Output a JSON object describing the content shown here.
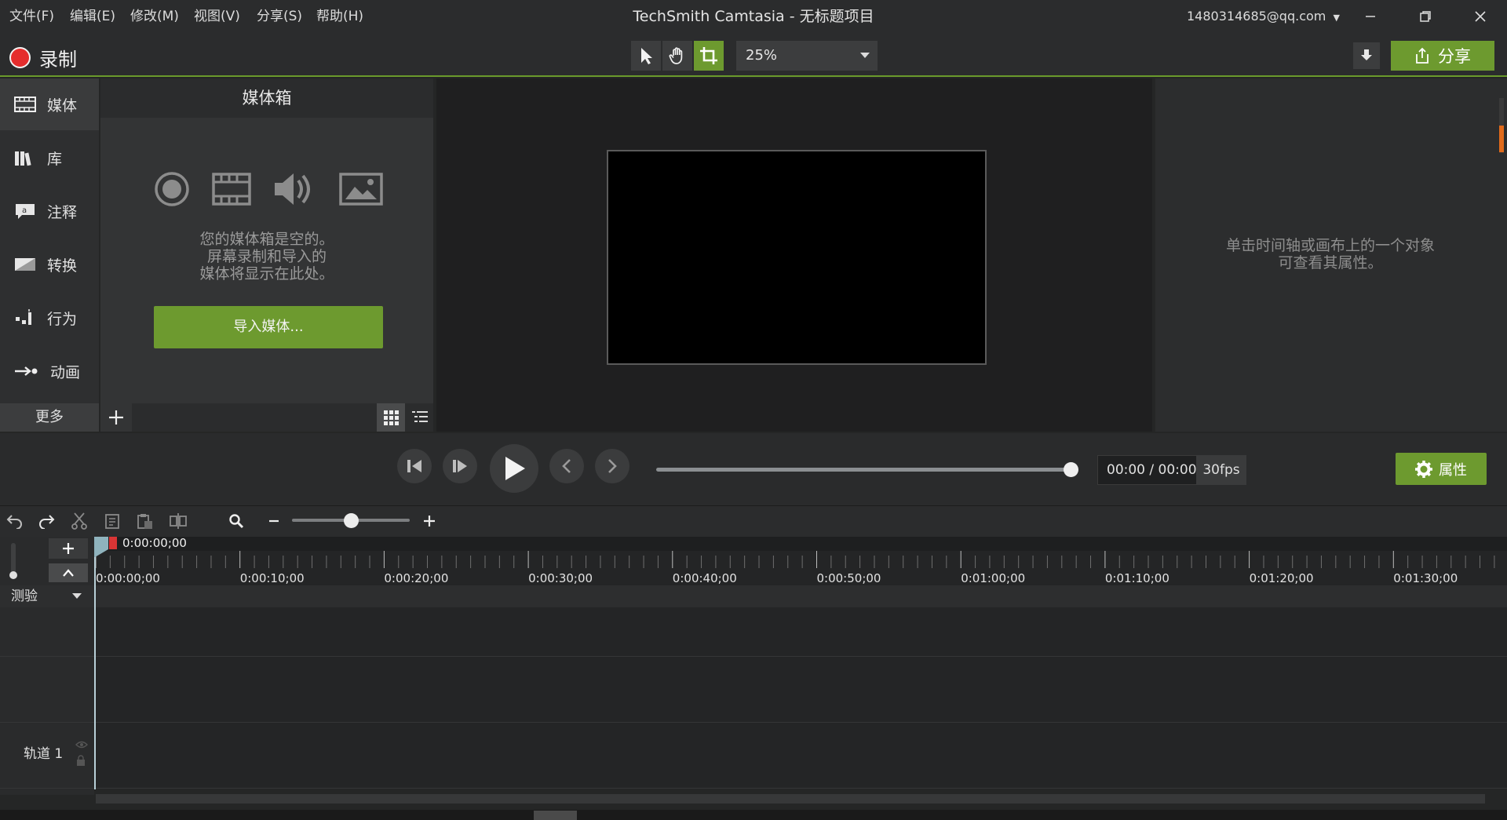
{
  "window": {
    "title": "TechSmith Camtasia - 无标题项目",
    "account": "1480314685@qq.com"
  },
  "menu": [
    "文件(F)",
    "编辑(E)",
    "修改(M)",
    "视图(V)",
    "分享(S)",
    "帮助(H)"
  ],
  "toolbar": {
    "record_label": "录制",
    "zoom_value": "25%",
    "share_label": "分享"
  },
  "sidebar": {
    "items": [
      {
        "label": "媒体",
        "icon": "film-icon"
      },
      {
        "label": "库",
        "icon": "library-icon"
      },
      {
        "label": "注释",
        "icon": "annotation-icon"
      },
      {
        "label": "转换",
        "icon": "transition-icon"
      },
      {
        "label": "行为",
        "icon": "behavior-icon"
      },
      {
        "label": "动画",
        "icon": "animation-icon"
      }
    ],
    "more_label": "更多"
  },
  "media_bin": {
    "header": "媒体箱",
    "empty_lines": [
      "您的媒体箱是空的。",
      "屏幕录制和导入的",
      "媒体将显示在此处。"
    ],
    "import_label": "导入媒体..."
  },
  "properties_panel": {
    "hint_lines": [
      "单击时间轴或画布上的一个对象",
      "可查看其属性。"
    ]
  },
  "playback": {
    "timecode": "00:00 / 00:00",
    "fps": "30fps",
    "properties_label": "属性",
    "scrub_position": 1.0
  },
  "timeline": {
    "playhead_time": "0:00:00;00",
    "ticks": [
      "0:00:00;00",
      "0:00:10;00",
      "0:00:20;00",
      "0:00:30;00",
      "0:00:40;00",
      "0:00:50;00",
      "0:01:00;00",
      "0:01:10;00",
      "0:01:20;00",
      "0:01:30;00"
    ],
    "group_label": "测验",
    "track_label": "轨道 1"
  },
  "colors": {
    "accent_green": "#6d9a2f",
    "record_red": "#e52d2d",
    "scrollbar_orange": "#e06a1a"
  }
}
